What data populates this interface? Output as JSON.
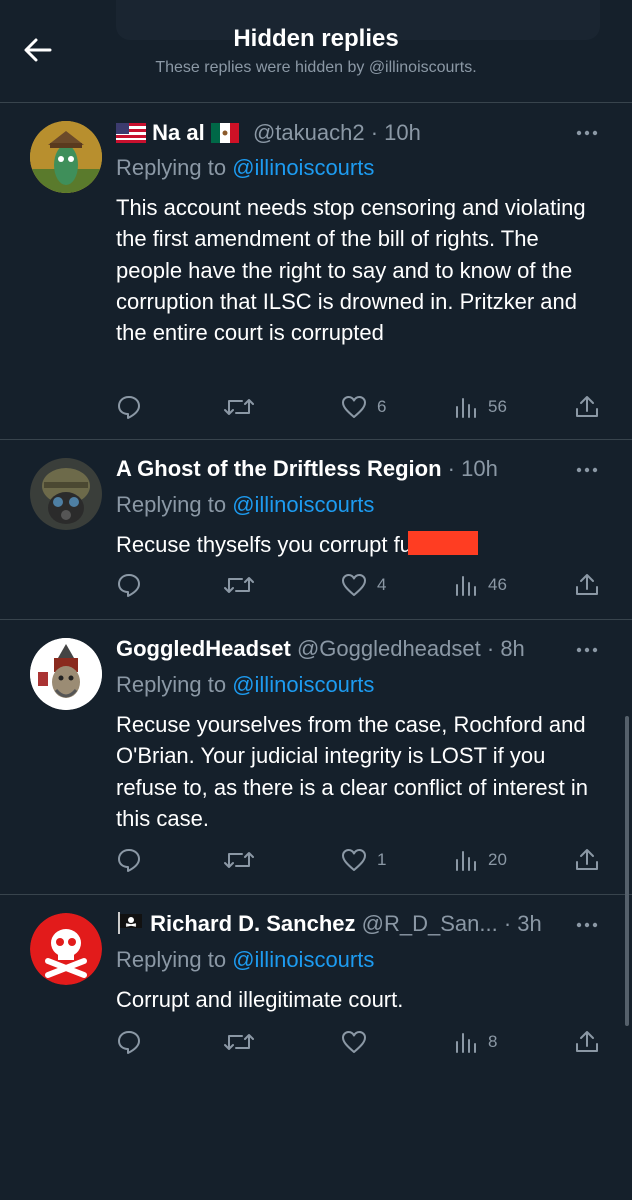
{
  "header": {
    "title": "Hidden replies",
    "subtitle": "These replies were hidden by @illinoiscourts."
  },
  "tweets": [
    {
      "name": "Na al",
      "handle": "@takuach2",
      "time": "· 10h",
      "replying_label": "Replying to",
      "replying_to": "@illinoiscourts",
      "text": "This account needs stop censoring and violating the first amendment of the bill of rights. The people have the right to say and to know of the corruption that ILSC is drowned in. Pritzker and the entire court is corrupted",
      "likes": "6",
      "views": "56"
    },
    {
      "name": "A Ghost of the Driftless Region",
      "handle": "",
      "time": "· 10h",
      "replying_label": "Replying to",
      "replying_to": "@illinoiscourts",
      "text": "Recuse thyselfs you corrupt fu",
      "likes": "4",
      "views": "46"
    },
    {
      "name": "GoggledHeadset",
      "handle": "@Goggledheadset",
      "time": "· 8h",
      "replying_label": "Replying to",
      "replying_to": "@illinoiscourts",
      "text": "Recuse yourselves from the case, Rochford and O'Brian. Your judicial integrity is LOST if you refuse to, as there is a clear conflict of interest in this case.",
      "likes": "1",
      "views": "20"
    },
    {
      "name": "Richard D. Sanchez",
      "handle": "@R_D_San...",
      "time": "· 3h",
      "replying_label": "Replying to",
      "replying_to": "@illinoiscourts",
      "text": "Corrupt and illegitimate court.",
      "likes": "",
      "views": "8"
    }
  ],
  "icons": {
    "back": "arrow-left-icon",
    "more": "more-dots-icon",
    "reply": "reply-icon",
    "retweet": "retweet-icon",
    "like": "heart-icon",
    "views": "views-icon",
    "share": "share-icon"
  },
  "colors": {
    "background": "#15202b",
    "link": "#1d9bf0",
    "secondary_text": "#8b98a5",
    "redaction": "#ff3d22"
  }
}
